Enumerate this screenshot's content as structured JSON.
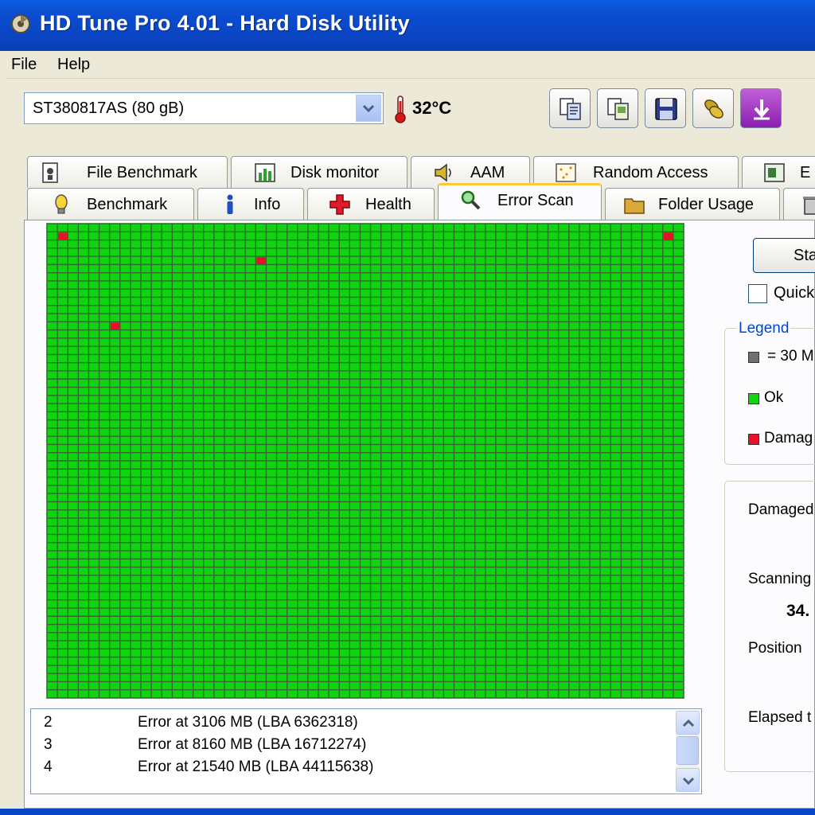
{
  "window": {
    "title": "HD Tune Pro 4.01 - Hard Disk Utility"
  },
  "menu": [
    {
      "label": "File"
    },
    {
      "label": "Help"
    }
  ],
  "toolbar": {
    "drive": "ST380817AS (80 gB)",
    "temperature": "32°C",
    "buttons": [
      "copy-text-icon",
      "copy-screen-icon",
      "save-icon",
      "options-icon",
      "exit-icon"
    ]
  },
  "tabs": {
    "row_top": [
      {
        "label": "File Benchmark",
        "icon": "file-benchmark-icon"
      },
      {
        "label": "Disk monitor",
        "icon": "disk-monitor-icon"
      },
      {
        "label": "AAM",
        "icon": "speaker-icon"
      },
      {
        "label": "Random Access",
        "icon": "random-access-icon"
      },
      {
        "label": "E",
        "icon": "extra-tests-icon"
      }
    ],
    "row_bottom": [
      {
        "label": "Benchmark",
        "icon": "lightbulb-icon"
      },
      {
        "label": "Info",
        "icon": "info-icon"
      },
      {
        "label": "Health",
        "icon": "health-cross-icon"
      },
      {
        "label": "Error Scan",
        "icon": "magnifier-icon",
        "active": true
      },
      {
        "label": "Folder Usage",
        "icon": "folder-icon"
      }
    ]
  },
  "scan_map": {
    "colors": {
      "ok": "#0fd40f",
      "damaged": "#e8102a",
      "grid_line": "#2e6b2e"
    },
    "damaged_blocks": [
      {
        "row": 1,
        "col": 1
      },
      {
        "row": 1,
        "col": 59
      },
      {
        "row": 4,
        "col": 20
      },
      {
        "row": 12,
        "col": 6
      }
    ]
  },
  "log": [
    {
      "num": "2",
      "msg": "Error at 3106 MB (LBA 6362318)"
    },
    {
      "num": "3",
      "msg": "Error at 8160 MB (LBA 16712274)"
    },
    {
      "num": "4",
      "msg": "Error at 21540 MB (LBA 44115638)"
    }
  ],
  "side": {
    "start_label": "Sta",
    "quick_label": "Quick",
    "legend_title": "Legend",
    "legend": [
      {
        "text": "= 30 M",
        "color": "#707070"
      },
      {
        "text": "Ok",
        "color": "#0fd40f"
      },
      {
        "text": "Damag",
        "color": "#e8102a"
      }
    ],
    "damaged_label": "Damaged",
    "scanning_label": "Scanning",
    "scanning_value": "34.",
    "position_label": "Position",
    "elapsed_label": "Elapsed t"
  }
}
